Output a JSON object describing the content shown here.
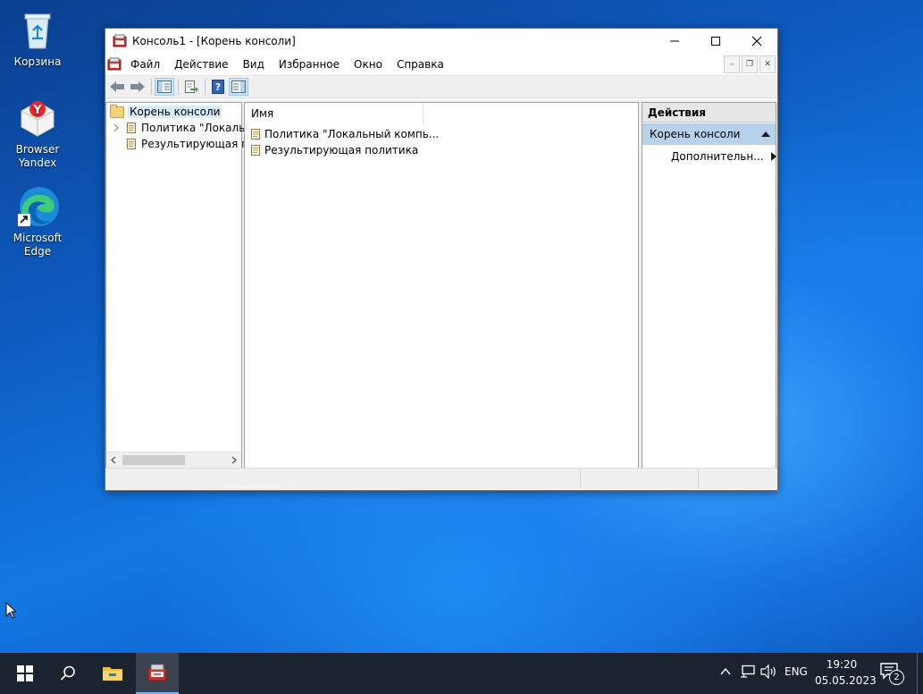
{
  "desktop_icons": [
    {
      "name": "recycle-bin",
      "label": "Корзина"
    },
    {
      "name": "yandex-browser",
      "label": "Browser\nYandex"
    },
    {
      "name": "edge",
      "label": "Microsoft\nEdge"
    }
  ],
  "window": {
    "title": "Консоль1 - [Корень консоли]",
    "menu": [
      "Файл",
      "Действие",
      "Вид",
      "Избранное",
      "Окно",
      "Справка"
    ]
  },
  "tree": {
    "root": "Корень консоли",
    "items": [
      "Политика \"Локальны",
      "Результирующая п"
    ]
  },
  "list": {
    "column_name": "Имя",
    "rows": [
      "Политика \"Локальный компь...",
      "Результирующая политика"
    ]
  },
  "actions": {
    "title": "Действия",
    "section": "Корень консоли",
    "more": "Дополнительн..."
  },
  "taskbar": {
    "language": "ENG",
    "time": "19:20",
    "date": "05.05.2023",
    "notification_count": "2"
  },
  "colors": {
    "taskbar_bg": "#1c2330",
    "actions_section_bg": "#b8d1ea",
    "selection_bg": "#d9ebf9"
  }
}
